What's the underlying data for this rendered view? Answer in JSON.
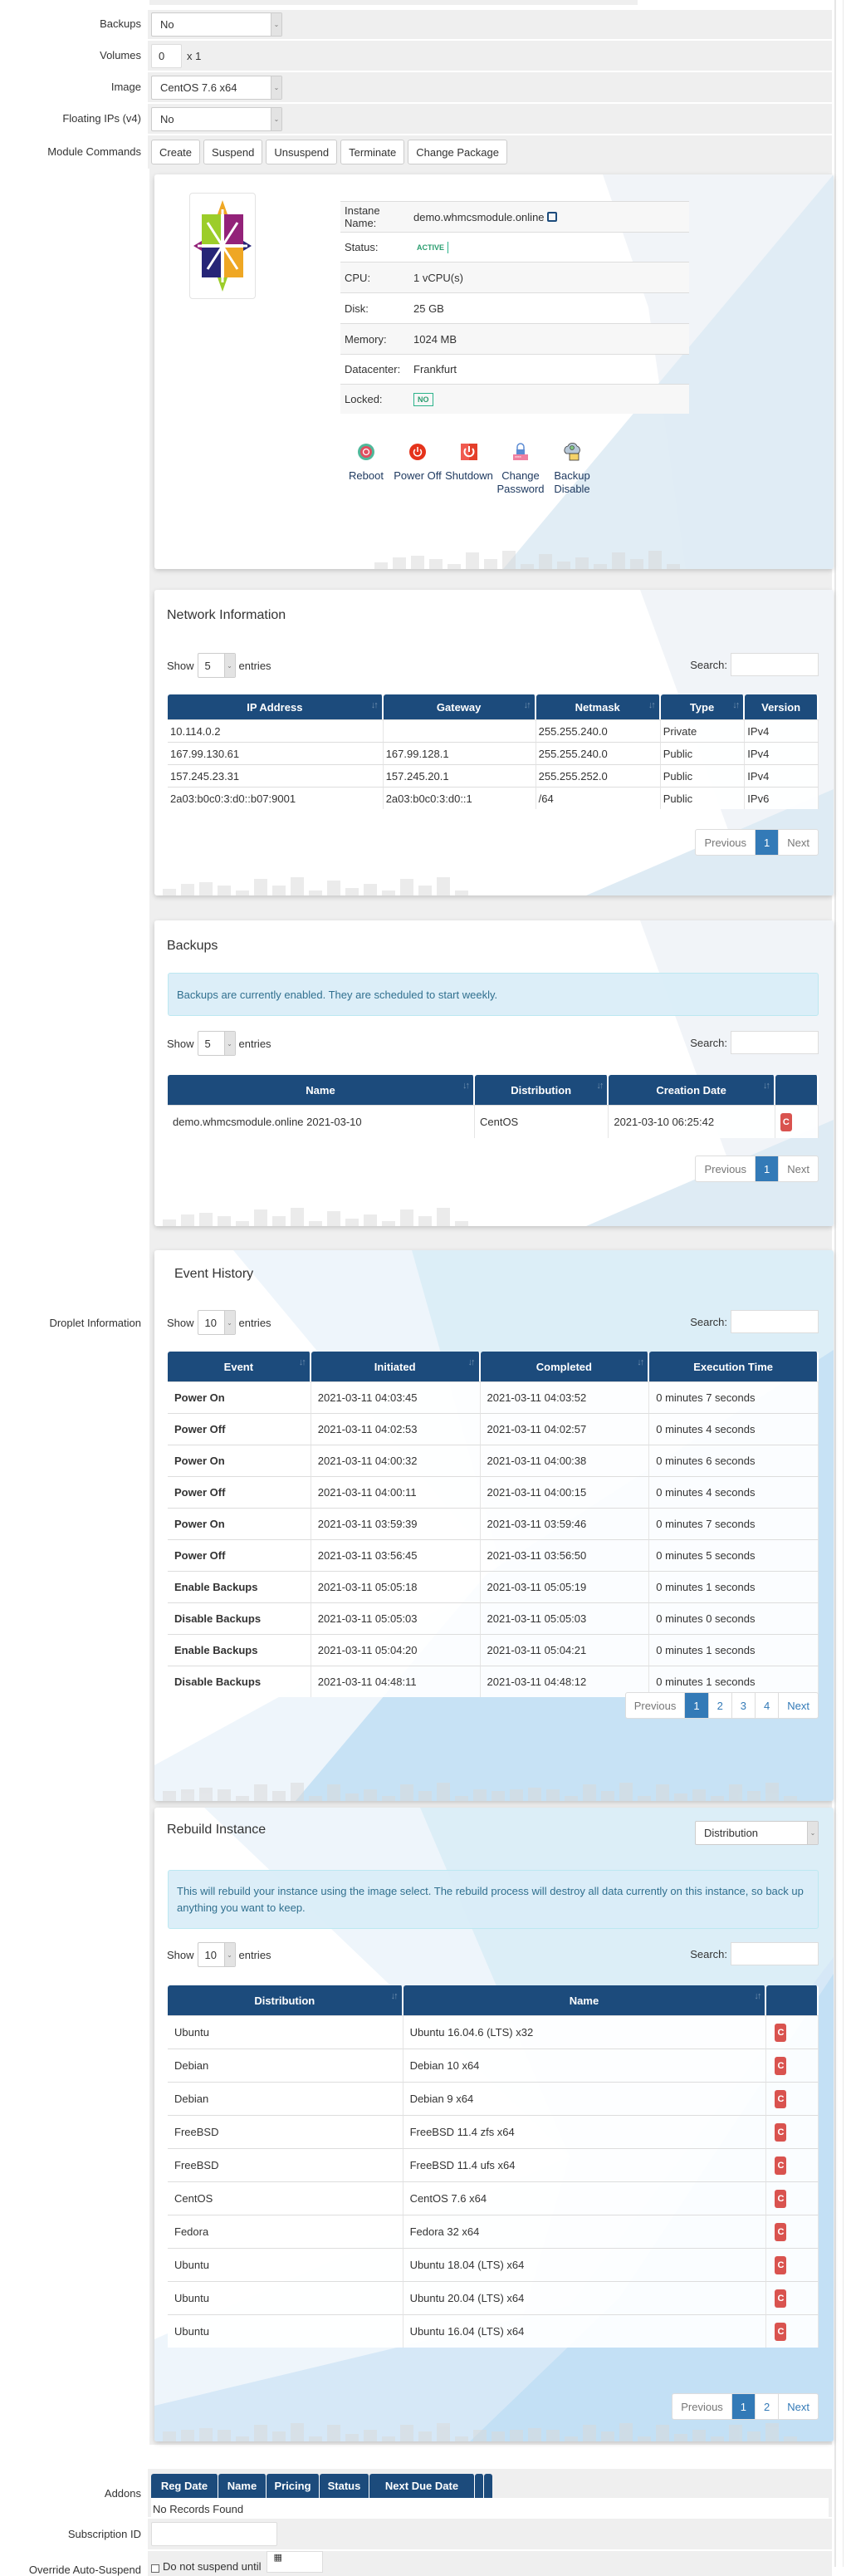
{
  "form": {
    "backups": {
      "label": "Backups",
      "value": "No"
    },
    "volumes": {
      "label": "Volumes",
      "value": "0",
      "suffix": "x 1"
    },
    "image": {
      "label": "Image",
      "value": "CentOS 7.6 x64"
    },
    "floating_ips": {
      "label": "Floating IPs (v4)",
      "value": "No"
    },
    "module_commands": {
      "label": "Module Commands",
      "buttons": [
        "Create",
        "Suspend",
        "Unsuspend",
        "Terminate",
        "Change Package"
      ]
    },
    "droplet_label": "Droplet Information",
    "addons": {
      "label": "Addons",
      "columns": [
        "Reg Date",
        "Name",
        "Pricing",
        "Status",
        "Next Due Date"
      ],
      "empty": "No Records Found"
    },
    "subscription": {
      "label": "Subscription ID",
      "value": ""
    },
    "override": {
      "label": "Override Auto-Suspend",
      "checkbox_label": "Do not suspend until"
    }
  },
  "instance": {
    "rows": [
      {
        "label": "Instane Name:",
        "value": "demo.whmcsmodule.online"
      },
      {
        "label": "Status:",
        "value": "ACTIVE"
      },
      {
        "label": "CPU:",
        "value": "1 vCPU(s)"
      },
      {
        "label": "Disk:",
        "value": "25 GB"
      },
      {
        "label": "Memory:",
        "value": "1024 MB"
      },
      {
        "label": "Datacenter:",
        "value": "Frankfurt"
      },
      {
        "label": "Locked:",
        "value": "NO"
      }
    ],
    "actions": [
      {
        "label1": "Reboot",
        "label2": ""
      },
      {
        "label1": "Power Off",
        "label2": ""
      },
      {
        "label1": "Shutdown",
        "label2": ""
      },
      {
        "label1": "Change",
        "label2": "Password"
      },
      {
        "label1": "Backup",
        "label2": "Disable"
      }
    ]
  },
  "network": {
    "title": "Network Information",
    "show_label": "Show",
    "entries_label": "entries",
    "show_value": "5",
    "search_label": "Search:",
    "columns": [
      "IP Address",
      "Gateway",
      "Netmask",
      "Type",
      "Version"
    ],
    "rows": [
      [
        "10.114.0.2",
        "",
        "255.255.240.0",
        "Private",
        "IPv4"
      ],
      [
        "167.99.130.61",
        "167.99.128.1",
        "255.255.240.0",
        "Public",
        "IPv4"
      ],
      [
        "157.245.23.31",
        "157.245.20.1",
        "255.255.252.0",
        "Public",
        "IPv4"
      ],
      [
        "2a03:b0c0:3:d0::b07:9001",
        "2a03:b0c0:3:d0::1",
        "/64",
        "Public",
        "IPv6"
      ]
    ],
    "pager": [
      "Previous",
      "1",
      "Next"
    ]
  },
  "backups": {
    "title": "Backups",
    "alert": "Backups are currently enabled. They are scheduled to start weekly.",
    "show_label": "Show",
    "entries_label": "entries",
    "show_value": "5",
    "search_label": "Search:",
    "columns": [
      "Name",
      "Distribution",
      "Creation Date",
      ""
    ],
    "rows": [
      [
        "demo.whmcsmodule.online 2021-03-10",
        "CentOS",
        "2021-03-10 06:25:42"
      ]
    ],
    "restore_glyph": "C",
    "pager": [
      "Previous",
      "1",
      "Next"
    ]
  },
  "events": {
    "title": "Event History",
    "show_label": "Show",
    "entries_label": "entries",
    "show_value": "10",
    "search_label": "Search:",
    "columns": [
      "Event",
      "Initiated",
      "Completed",
      "Execution Time"
    ],
    "rows": [
      [
        "Power On",
        "2021-03-11 04:03:45",
        "2021-03-11 04:03:52",
        "0 minutes 7 seconds"
      ],
      [
        "Power Off",
        "2021-03-11 04:02:53",
        "2021-03-11 04:02:57",
        "0 minutes 4 seconds"
      ],
      [
        "Power On",
        "2021-03-11 04:00:32",
        "2021-03-11 04:00:38",
        "0 minutes 6 seconds"
      ],
      [
        "Power Off",
        "2021-03-11 04:00:11",
        "2021-03-11 04:00:15",
        "0 minutes 4 seconds"
      ],
      [
        "Power On",
        "2021-03-11 03:59:39",
        "2021-03-11 03:59:46",
        "0 minutes 7 seconds"
      ],
      [
        "Power Off",
        "2021-03-11 03:56:45",
        "2021-03-11 03:56:50",
        "0 minutes 5 seconds"
      ],
      [
        "Enable Backups",
        "2021-03-11 05:05:18",
        "2021-03-11 05:05:19",
        "0 minutes 1 seconds"
      ],
      [
        "Disable Backups",
        "2021-03-11 05:05:03",
        "2021-03-11 05:05:03",
        "0 minutes 0 seconds"
      ],
      [
        "Enable Backups",
        "2021-03-11 05:04:20",
        "2021-03-11 05:04:21",
        "0 minutes 1 seconds"
      ],
      [
        "Disable Backups",
        "2021-03-11 04:48:11",
        "2021-03-11 04:48:12",
        "0 minutes 1 seconds"
      ]
    ],
    "pager": [
      "Previous",
      "1",
      "2",
      "3",
      "4",
      "Next"
    ]
  },
  "rebuild": {
    "title": "Rebuild Instance",
    "filter_value": "Distribution",
    "alert": "This will rebuild your instance using the image select. The rebuild process will destroy all data currently on this instance, so back up anything you want to keep.",
    "show_label": "Show",
    "entries_label": "entries",
    "show_value": "10",
    "search_label": "Search:",
    "columns": [
      "Distribution",
      "Name",
      ""
    ],
    "rows": [
      [
        "Ubuntu",
        "Ubuntu 16.04.6 (LTS) x32"
      ],
      [
        "Debian",
        "Debian 10 x64"
      ],
      [
        "Debian",
        "Debian 9 x64"
      ],
      [
        "FreeBSD",
        "FreeBSD 11.4 zfs x64"
      ],
      [
        "FreeBSD",
        "FreeBSD 11.4 ufs x64"
      ],
      [
        "CentOS",
        "CentOS 7.6 x64"
      ],
      [
        "Fedora",
        "Fedora 32 x64"
      ],
      [
        "Ubuntu",
        "Ubuntu 18.04 (LTS) x64"
      ],
      [
        "Ubuntu",
        "Ubuntu 20.04 (LTS) x64"
      ],
      [
        "Ubuntu",
        "Ubuntu 16.04 (LTS) x64"
      ]
    ],
    "restore_glyph": "C",
    "pager": [
      "Previous",
      "1",
      "2",
      "Next"
    ]
  }
}
